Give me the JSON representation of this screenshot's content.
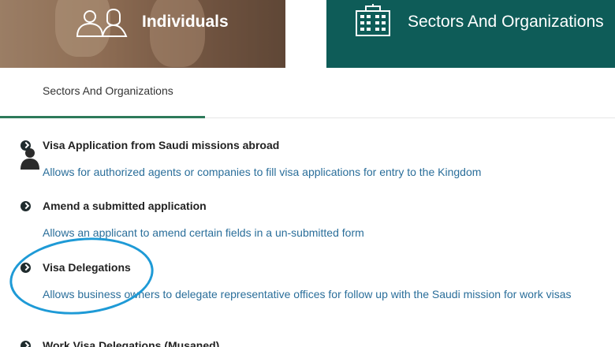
{
  "tabs": {
    "individuals": {
      "label": "Individuals"
    },
    "sectors": {
      "label": "Sectors And Organizations"
    }
  },
  "subheader": {
    "title": "Sectors And Organizations"
  },
  "services": [
    {
      "title": "Visa Application from Saudi missions abroad",
      "description": "Allows for authorized agents or companies to fill visa applications for entry to the Kingdom"
    },
    {
      "title": "Amend a submitted application",
      "description": "Allows an applicant to amend certain fields in a un-submitted form"
    },
    {
      "title": "Visa Delegations",
      "description": "Allows business owners to delegate representative offices for follow up with the Saudi mission for work visas"
    },
    {
      "title": "Work Visa Delegations (Musaned)"
    }
  ],
  "colors": {
    "sectors_tab": "#0e5c58",
    "link_text": "#2a6e9a",
    "highlight_circle": "#1e9ad6",
    "active_underline": "#2d7a5a"
  },
  "icons": {
    "individuals": "people-icon",
    "sectors": "building-icon",
    "subheader": "person-icon",
    "bullet": "chevron-right-circle-icon"
  }
}
